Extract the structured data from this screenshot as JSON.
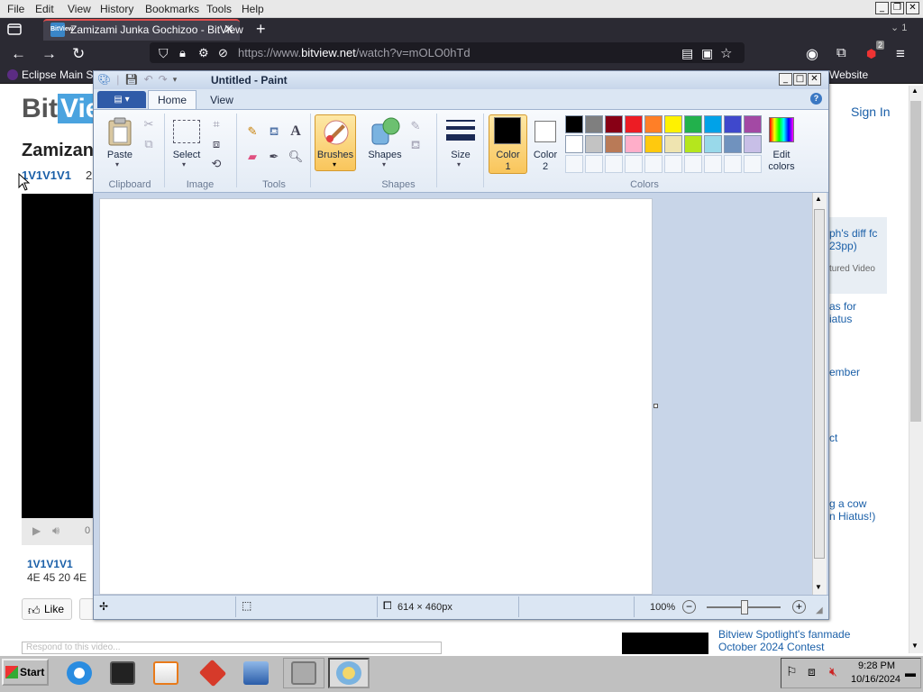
{
  "browser": {
    "menu": [
      "File",
      "Edit",
      "View",
      "History",
      "Bookmarks",
      "Tools",
      "Help"
    ],
    "tab_title": "Zamizami Junka Gochizoo - BitView",
    "tab_favicon": "BitView",
    "url_prefix": "https://www.",
    "url_domain": "bitview.net",
    "url_path": "/watch?v=mOLO0hTd",
    "bookmark_left": "Eclipse Main Site",
    "bookmark_right": "Website",
    "extension_badge": "2",
    "tab_count_hint": "1"
  },
  "page": {
    "logo_bit": "Bit",
    "logo_view": "View",
    "title_fragment": "Zamizan",
    "uploader": "1V1V1V1",
    "upload_num": "2",
    "player_time": "0",
    "desc_user": "1V1V1V1",
    "desc_text": "4E 45 20 4E",
    "like": "Like",
    "comment_placeholder": "Respond to this video...",
    "signin": "Sign In",
    "sidebar": {
      "item1": "ph's diff fc",
      "item1b": "23pp)",
      "featured": "tured Video",
      "item2": "as for",
      "item2b": "iatus",
      "item3": "ember",
      "item4": "ct",
      "item5": "g a cow",
      "item5b": "n Hiatus!)"
    },
    "spotlight_line1": "Bitview Spotlight's fanmade",
    "spotlight_line2": "October 2024 Contest"
  },
  "paint": {
    "title": "Untitled - Paint",
    "tabs": [
      "Home",
      "View"
    ],
    "groups": {
      "clipboard": "Clipboard",
      "image": "Image",
      "tools": "Tools",
      "shapes": "Shapes",
      "colors": "Colors"
    },
    "buttons": {
      "paste": "Paste",
      "select": "Select",
      "brushes": "Brushes",
      "shapes": "Shapes",
      "size": "Size",
      "color1": "Color 1",
      "color1a": "Color",
      "color1b": "1",
      "color2a": "Color",
      "color2b": "2",
      "edit_colors_a": "Edit",
      "edit_colors_b": "colors"
    },
    "palette_row1": [
      "#000000",
      "#7f7f7f",
      "#880015",
      "#ed1c24",
      "#ff7f27",
      "#fff200",
      "#22b14c",
      "#00a2e8",
      "#3f48cc",
      "#a349a4"
    ],
    "palette_row2": [
      "#ffffff",
      "#c3c3c3",
      "#b97a57",
      "#ffaec9",
      "#ffc90e",
      "#efe4b0",
      "#b5e61d",
      "#99d9ea",
      "#7092be",
      "#c8bfe7"
    ],
    "color1": "#000000",
    "color2": "#ffffff",
    "status_dims": "614 × 460px",
    "zoom": "100%"
  },
  "taskbar": {
    "start": "Start",
    "time": "9:28 PM",
    "date": "10/16/2024"
  }
}
